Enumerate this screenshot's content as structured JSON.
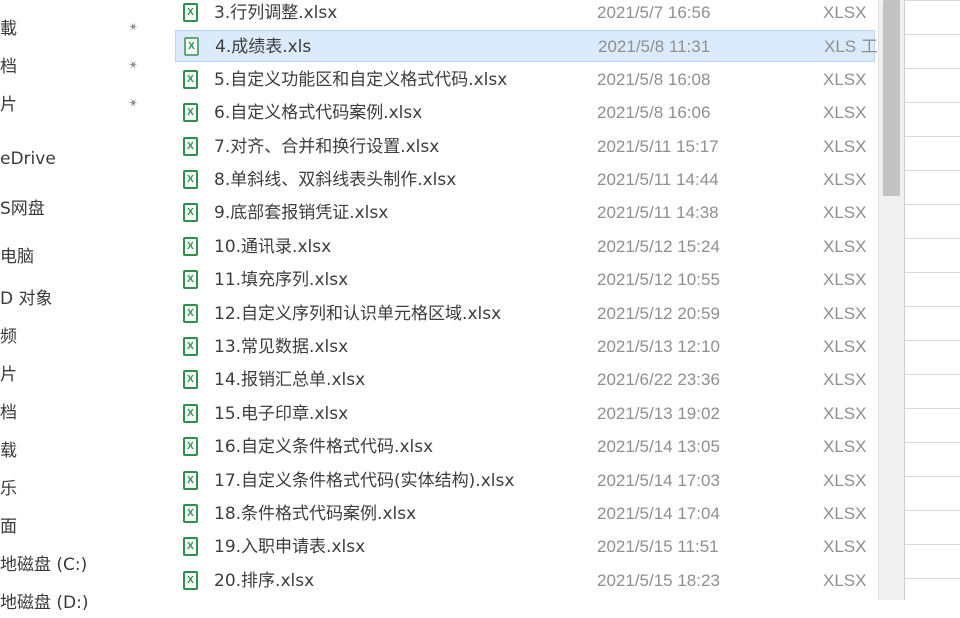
{
  "nav": {
    "items": [
      {
        "label": "載",
        "pinned": true
      },
      {
        "label": "档",
        "pinned": true
      },
      {
        "label": "片",
        "pinned": true
      },
      {
        "label": "eDrive",
        "pinned": false
      },
      {
        "label": "S网盘",
        "pinned": false
      },
      {
        "label": "电脑",
        "pinned": false
      },
      {
        "label": "D 对象",
        "pinned": false
      },
      {
        "label": "频",
        "pinned": false
      },
      {
        "label": "片",
        "pinned": false
      },
      {
        "label": "档",
        "pinned": false
      },
      {
        "label": "载",
        "pinned": false
      },
      {
        "label": "乐",
        "pinned": false
      },
      {
        "label": "面",
        "pinned": false
      },
      {
        "label": "地磁盘 (C:)",
        "pinned": false
      },
      {
        "label": "地磁盘 (D:)",
        "pinned": false
      }
    ]
  },
  "files": [
    {
      "name": "3.行列调整.xlsx",
      "date": "2021/5/7 16:56",
      "type": "XLSX",
      "selected": false,
      "format": "xlsx"
    },
    {
      "name": "4.成绩表.xls",
      "date": "2021/5/8 11:31",
      "type": "XLS 工",
      "selected": true,
      "format": "xls"
    },
    {
      "name": "5.自定义功能区和自定义格式代码.xlsx",
      "date": "2021/5/8 16:08",
      "type": "XLSX",
      "selected": false,
      "format": "xlsx"
    },
    {
      "name": "6.自定义格式代码案例.xlsx",
      "date": "2021/5/8 16:06",
      "type": "XLSX",
      "selected": false,
      "format": "xlsx"
    },
    {
      "name": "7.对齐、合并和换行设置.xlsx",
      "date": "2021/5/11 15:17",
      "type": "XLSX",
      "selected": false,
      "format": "xlsx"
    },
    {
      "name": "8.单斜线、双斜线表头制作.xlsx",
      "date": "2021/5/11 14:44",
      "type": "XLSX",
      "selected": false,
      "format": "xlsx"
    },
    {
      "name": "9.底部套报销凭证.xlsx",
      "date": "2021/5/11 14:38",
      "type": "XLSX",
      "selected": false,
      "format": "xlsx"
    },
    {
      "name": "10.通讯录.xlsx",
      "date": "2021/5/12 15:24",
      "type": "XLSX",
      "selected": false,
      "format": "xlsx"
    },
    {
      "name": "11.填充序列.xlsx",
      "date": "2021/5/12 10:55",
      "type": "XLSX",
      "selected": false,
      "format": "xlsx"
    },
    {
      "name": "12.自定义序列和认识单元格区域.xlsx",
      "date": "2021/5/12 20:59",
      "type": "XLSX",
      "selected": false,
      "format": "xlsx"
    },
    {
      "name": "13.常见数据.xlsx",
      "date": "2021/5/13 12:10",
      "type": "XLSX",
      "selected": false,
      "format": "xlsx"
    },
    {
      "name": "14.报销汇总单.xlsx",
      "date": "2021/6/22 23:36",
      "type": "XLSX",
      "selected": false,
      "format": "xlsx"
    },
    {
      "name": "15.电子印章.xlsx",
      "date": "2021/5/13 19:02",
      "type": "XLSX",
      "selected": false,
      "format": "xlsx"
    },
    {
      "name": "16.自定义条件格式代码.xlsx",
      "date": "2021/5/14 13:05",
      "type": "XLSX",
      "selected": false,
      "format": "xlsx"
    },
    {
      "name": "17.自定义条件格式代码(实体结构).xlsx",
      "date": "2021/5/14 17:03",
      "type": "XLSX",
      "selected": false,
      "format": "xlsx"
    },
    {
      "name": "18.条件格式代码案例.xlsx",
      "date": "2021/5/14 17:04",
      "type": "XLSX",
      "selected": false,
      "format": "xlsx"
    },
    {
      "name": "19.入职申请表.xlsx",
      "date": "2021/5/15 11:51",
      "type": "XLSX",
      "selected": false,
      "format": "xlsx"
    },
    {
      "name": "20.排序.xlsx",
      "date": "2021/5/15 18:23",
      "type": "XLSX",
      "selected": false,
      "format": "xlsx"
    }
  ],
  "icons": {
    "file_icon_glyph": "X",
    "pin_glyph": "📌"
  },
  "colors": {
    "selection": "#dcebfc",
    "excel_green": "#2f8f4c"
  }
}
